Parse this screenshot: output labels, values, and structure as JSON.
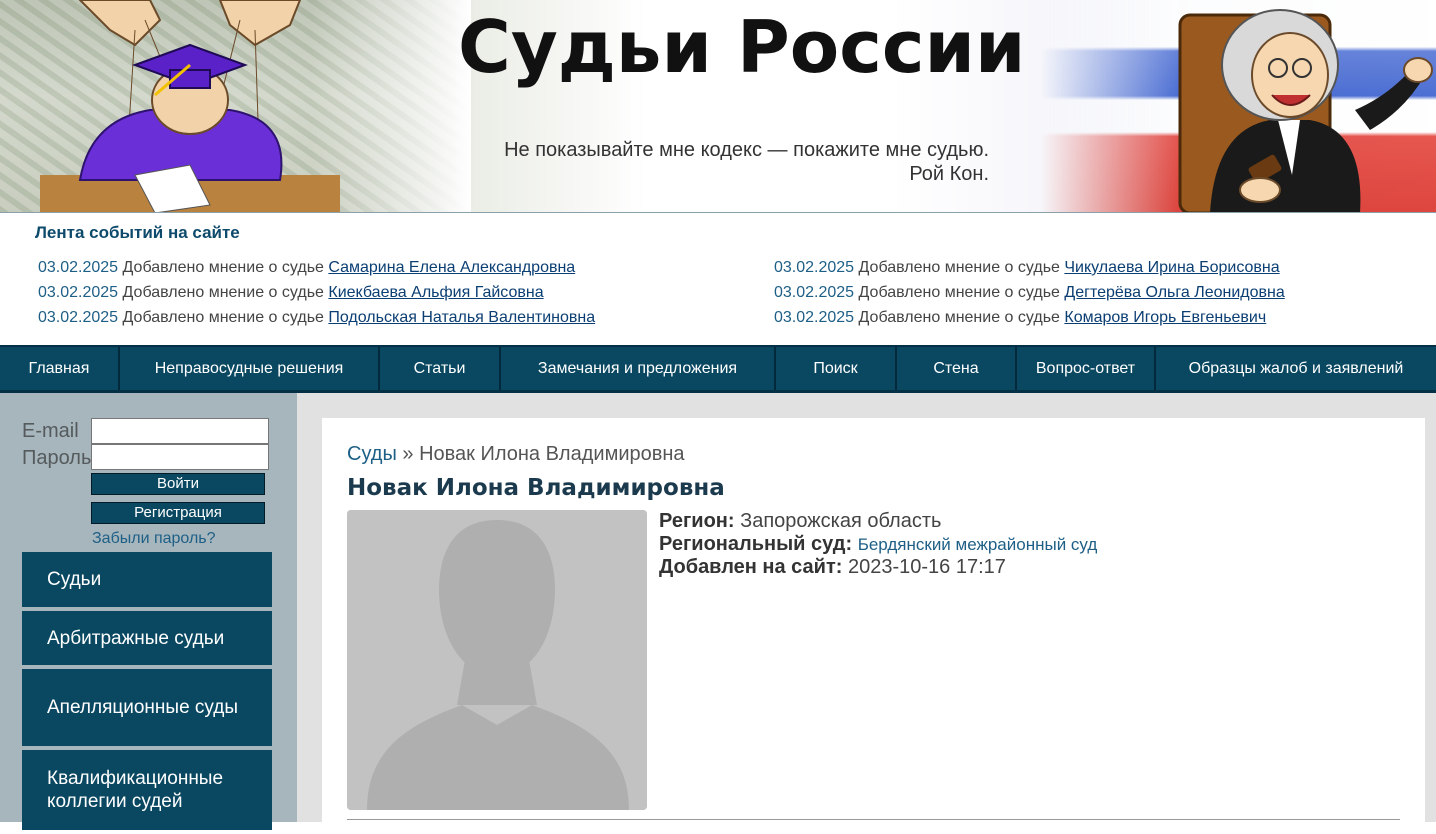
{
  "header": {
    "site_title": "Судьи России",
    "quote_line1": "Не показывайте мне кодекс — покажите мне судью.",
    "quote_line2": "Рой Кон."
  },
  "feed": {
    "title": "Лента событий на сайте",
    "items": [
      {
        "date": "03.02.2025",
        "text": "Добавлено мнение о судье",
        "name": "Самарина Елена Александровна"
      },
      {
        "date": "03.02.2025",
        "text": "Добавлено мнение о судье",
        "name": "Киекбаева Альфия Гайсовна"
      },
      {
        "date": "03.02.2025",
        "text": "Добавлено мнение о судье",
        "name": "Подольская Наталья Валентиновна"
      },
      {
        "date": "03.02.2025",
        "text": "Добавлено мнение о судье",
        "name": "Чикулаева Ирина Борисовна"
      },
      {
        "date": "03.02.2025",
        "text": "Добавлено мнение о судье",
        "name": "Дегтерёва Ольга Леонидовна"
      },
      {
        "date": "03.02.2025",
        "text": "Добавлено мнение о судье",
        "name": "Комаров Игорь Евгеньевич"
      }
    ]
  },
  "nav": {
    "items": [
      "Главная",
      "Неправосудные решения",
      "Статьи",
      "Замечания и предложения",
      "Поиск",
      "Стена",
      "Вопрос-ответ",
      "Образцы жалоб и заявлений"
    ]
  },
  "login": {
    "email_label": "E-mail",
    "password_label": "Пароль",
    "email_value": "",
    "password_value": "",
    "login_button": "Войти",
    "register_button": "Регистрация",
    "forgot_link": "Забыли пароль?"
  },
  "sidebar": {
    "items": [
      "Судьи",
      "Арбитражные судьи",
      "Апелляционные суды",
      "Квалификационные коллегии судей"
    ]
  },
  "main": {
    "breadcrumb_link": "Суды",
    "breadcrumb_sep": "»",
    "breadcrumb_current": "Новак Илона Владимировна",
    "title": "Новак Илона Владимировна",
    "region_label": "Регион:",
    "region_value": "Запорожская область",
    "court_label": "Региональный суд:",
    "court_value": "Бердянский межрайонный суд",
    "added_label": "Добавлен на сайт:",
    "added_value": "2023-10-16 17:17"
  },
  "colors": {
    "nav_bg": "#0a4862",
    "sidebar_bg": "#a7b6bd",
    "link": "#1e5f86",
    "title": "#1b3a4d"
  }
}
